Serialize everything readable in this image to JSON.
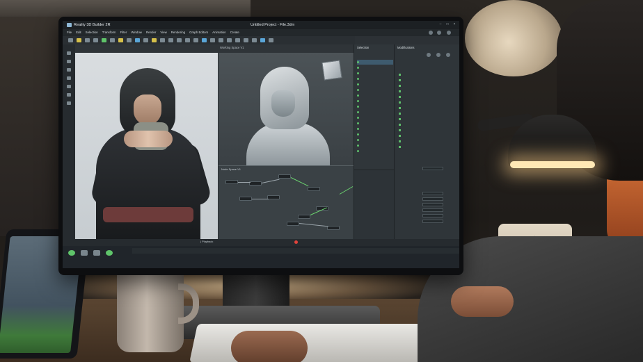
{
  "app": {
    "title": "Reality 3D Builder 2R",
    "document_title": "Untitled Project - File.3dm"
  },
  "menu": [
    "File",
    "Edit",
    "Selection",
    "Transform",
    "Filter",
    "Window",
    "Render",
    "View",
    "Rendering",
    "Graph Editors",
    "Animation",
    "Create"
  ],
  "viewports": {
    "right_label": "Working Space V1",
    "node_editor_label": "Node Space V1"
  },
  "outliner": {
    "title": "Selection"
  },
  "modifiers": {
    "title": "Modifications"
  },
  "timeline": {
    "label": "| Playback"
  },
  "colors": {
    "accent_green": "#5fc46a",
    "playhead_red": "#e0433c",
    "panel_bg": "#2c3135"
  },
  "icons": [
    "share-icon",
    "settings-icon",
    "render-icon",
    "move-icon",
    "rotate-icon",
    "scale-icon",
    "view-cube-icon",
    "play-icon"
  ]
}
